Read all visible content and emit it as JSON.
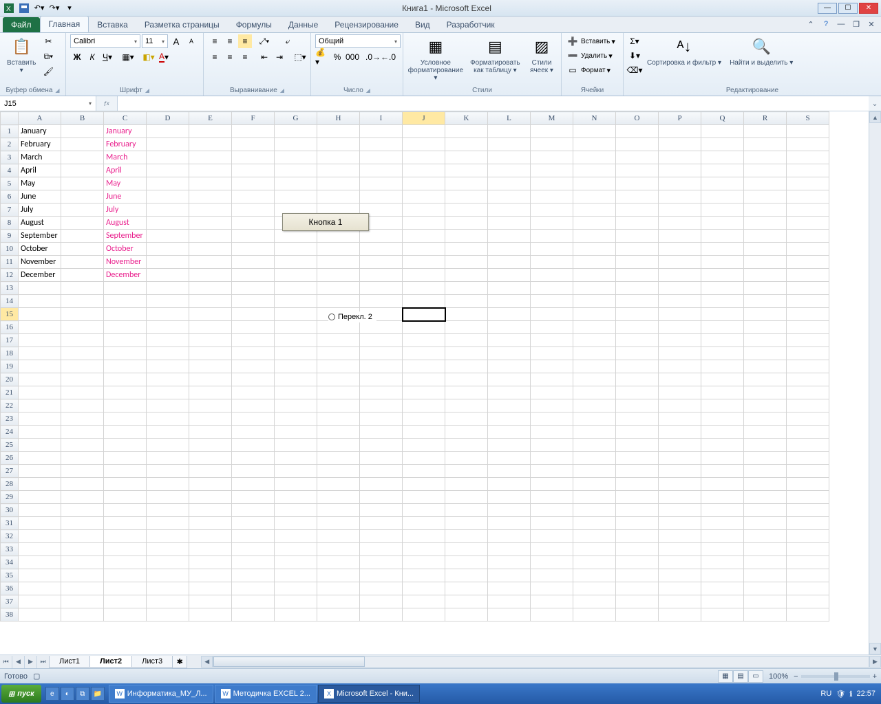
{
  "app_title": "Книга1  -  Microsoft Excel",
  "tabs": {
    "file": "Файл",
    "items": [
      "Главная",
      "Вставка",
      "Разметка страницы",
      "Формулы",
      "Данные",
      "Рецензирование",
      "Вид",
      "Разработчик"
    ],
    "active": 0
  },
  "ribbon": {
    "clipboard": {
      "label": "Буфер обмена",
      "paste": "Вставить"
    },
    "font": {
      "label": "Шрифт",
      "name": "Calibri",
      "size": "11"
    },
    "alignment": {
      "label": "Выравнивание"
    },
    "number": {
      "label": "Число",
      "format": "Общий"
    },
    "styles": {
      "label": "Стили",
      "cond": "Условное форматирование",
      "table": "Форматировать как таблицу",
      "cell": "Стили ячеек"
    },
    "cells": {
      "label": "Ячейки",
      "insert": "Вставить",
      "delete": "Удалить",
      "format": "Формат"
    },
    "editing": {
      "label": "Редактирование",
      "sort": "Сортировка и фильтр",
      "find": "Найти и выделить"
    }
  },
  "namebox": "J15",
  "formula": "",
  "columns": [
    "A",
    "B",
    "C",
    "D",
    "E",
    "F",
    "G",
    "H",
    "I",
    "J",
    "K",
    "L",
    "M",
    "N",
    "O",
    "P",
    "Q",
    "R",
    "S"
  ],
  "active_col": "J",
  "active_row": 15,
  "rows_count": 38,
  "months": [
    "January",
    "February",
    "March",
    "April",
    "May",
    "June",
    "July",
    "August",
    "September",
    "October",
    "November",
    "December"
  ],
  "form_button": "Кнопка 1",
  "form_radio": "Перекл. 2",
  "sheets": {
    "items": [
      "Лист1",
      "Лист2",
      "Лист3"
    ],
    "active": 1
  },
  "status": {
    "ready": "Готово",
    "zoom": "100%"
  },
  "taskbar": {
    "start": "пуск",
    "tasks": [
      {
        "label": "Информатика_МУ_Л...",
        "app": "W"
      },
      {
        "label": "Методичка EXCEL 2...",
        "app": "W"
      },
      {
        "label": "Microsoft Excel - Кни...",
        "app": "X",
        "active": true
      }
    ],
    "lang": "RU",
    "time": "22:57"
  }
}
